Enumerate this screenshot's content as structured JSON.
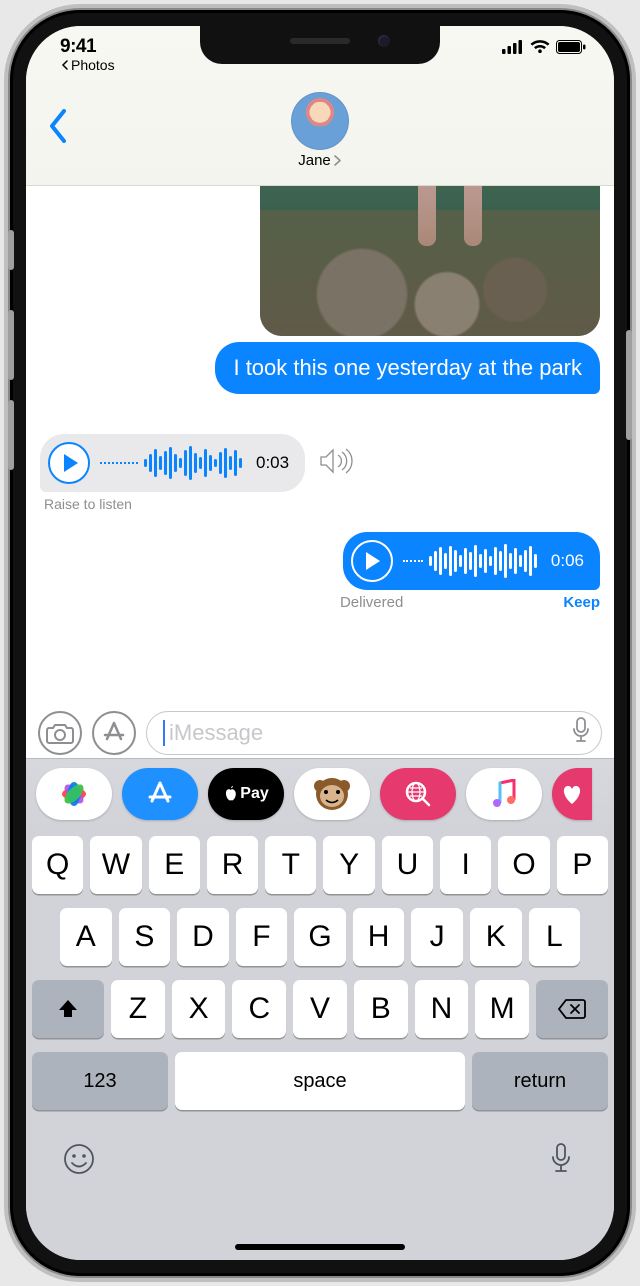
{
  "status": {
    "time": "9:41",
    "back_app": "Photos"
  },
  "header": {
    "contact_name": "Jane"
  },
  "messages": {
    "sent_text": "I took this one yesterday at the park",
    "audio_in_duration": "0:03",
    "raise_hint": "Raise to listen",
    "audio_out_duration": "0:06",
    "delivered": "Delivered",
    "keep": "Keep"
  },
  "input": {
    "placeholder": "iMessage"
  },
  "apps": {
    "pay_label": "Pay"
  },
  "keyboard": {
    "row1": [
      "Q",
      "W",
      "E",
      "R",
      "T",
      "Y",
      "U",
      "I",
      "O",
      "P"
    ],
    "row2": [
      "A",
      "S",
      "D",
      "F",
      "G",
      "H",
      "J",
      "K",
      "L"
    ],
    "row3": [
      "Z",
      "X",
      "C",
      "V",
      "B",
      "N",
      "M"
    ],
    "numbers": "123",
    "space": "space",
    "return": "return"
  }
}
